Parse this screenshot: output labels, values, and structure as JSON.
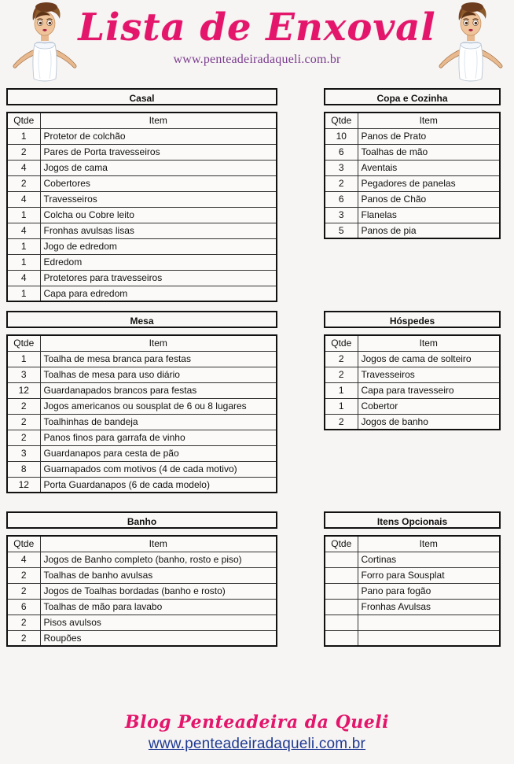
{
  "header": {
    "title": "Lista de Enxoval",
    "url": "www.penteadeiradaqueli.com.br",
    "title_color": "#e3166c",
    "url_color": "#7a3d8f",
    "left_illustration": "bride-illustration",
    "right_illustration": "bride-illustration"
  },
  "columns": {
    "qtde_header": "Qtde",
    "item_header": "Item"
  },
  "sections": [
    {
      "id": "casal",
      "title": "Casal",
      "column": "left",
      "rows": [
        {
          "qtde": "1",
          "item": "Protetor de colchão"
        },
        {
          "qtde": "2",
          "item": "Pares de Porta travesseiros"
        },
        {
          "qtde": "4",
          "item": "Jogos de cama"
        },
        {
          "qtde": "2",
          "item": "Cobertores"
        },
        {
          "qtde": "4",
          "item": "Travesseiros"
        },
        {
          "qtde": "1",
          "item": "Colcha ou Cobre leito"
        },
        {
          "qtde": "4",
          "item": "Fronhas avulsas lisas"
        },
        {
          "qtde": "1",
          "item": "Jogo de edredom"
        },
        {
          "qtde": "1",
          "item": "Edredom"
        },
        {
          "qtde": "4",
          "item": "Protetores para travesseiros"
        },
        {
          "qtde": "1",
          "item": "Capa para edredom"
        }
      ]
    },
    {
      "id": "copa-e-cozinha",
      "title": "Copa e Cozinha",
      "column": "right",
      "rows": [
        {
          "qtde": "10",
          "item": "Panos de Prato"
        },
        {
          "qtde": "6",
          "item": "Toalhas de mão"
        },
        {
          "qtde": "3",
          "item": "Aventais"
        },
        {
          "qtde": "2",
          "item": "Pegadores de panelas"
        },
        {
          "qtde": "6",
          "item": "Panos de Chão"
        },
        {
          "qtde": "3",
          "item": "Flanelas"
        },
        {
          "qtde": "5",
          "item": "Panos de pia"
        }
      ]
    },
    {
      "id": "mesa",
      "title": "Mesa",
      "column": "left",
      "rows": [
        {
          "qtde": "1",
          "item": "Toalha de mesa branca para festas"
        },
        {
          "qtde": "3",
          "item": "Toalhas de mesa para uso diário"
        },
        {
          "qtde": "12",
          "item": "Guardanapados brancos para festas"
        },
        {
          "qtde": "2",
          "item": "Jogos americanos ou sousplat de 6 ou 8 lugares"
        },
        {
          "qtde": "2",
          "item": "Toalhinhas de bandeja"
        },
        {
          "qtde": "2",
          "item": "Panos finos para garrafa de vinho"
        },
        {
          "qtde": "3",
          "item": "Guardanapos para cesta de pão"
        },
        {
          "qtde": "8",
          "item": "Guarnapados com motivos (4 de cada motivo)"
        },
        {
          "qtde": "12",
          "item": "Porta Guardanapos (6 de cada modelo)"
        }
      ]
    },
    {
      "id": "hospedes",
      "title": "Hóspedes",
      "column": "right",
      "rows": [
        {
          "qtde": "2",
          "item": "Jogos de cama de solteiro"
        },
        {
          "qtde": "2",
          "item": "Travesseiros"
        },
        {
          "qtde": "1",
          "item": "Capa para travesseiro"
        },
        {
          "qtde": "1",
          "item": "Cobertor"
        },
        {
          "qtde": "2",
          "item": "Jogos de banho"
        }
      ]
    },
    {
      "id": "banho",
      "title": "Banho",
      "column": "left",
      "rows": [
        {
          "qtde": "4",
          "item": "Jogos de Banho completo (banho, rosto e piso)"
        },
        {
          "qtde": "2",
          "item": "Toalhas de banho avulsas"
        },
        {
          "qtde": "2",
          "item": "Jogos de Toalhas bordadas (banho e rosto)"
        },
        {
          "qtde": "6",
          "item": "Toalhas de mão para lavabo"
        },
        {
          "qtde": "2",
          "item": "Pisos avulsos"
        },
        {
          "qtde": "2",
          "item": "Roupões"
        }
      ]
    },
    {
      "id": "itens-opcionais",
      "title": "Itens Opcionais",
      "column": "right",
      "rows": [
        {
          "qtde": "",
          "item": "Cortinas"
        },
        {
          "qtde": "",
          "item": "Forro para Sousplat"
        },
        {
          "qtde": "",
          "item": "Pano para fogão"
        },
        {
          "qtde": "",
          "item": "Fronhas Avulsas"
        },
        {
          "qtde": "",
          "item": ""
        },
        {
          "qtde": "",
          "item": ""
        }
      ]
    }
  ],
  "footer": {
    "blog": "Blog Penteadeira da Queli",
    "url": "www.penteadeiradaqueli.com.br",
    "blog_color": "#e3166c",
    "url_color": "#1f3a93"
  }
}
